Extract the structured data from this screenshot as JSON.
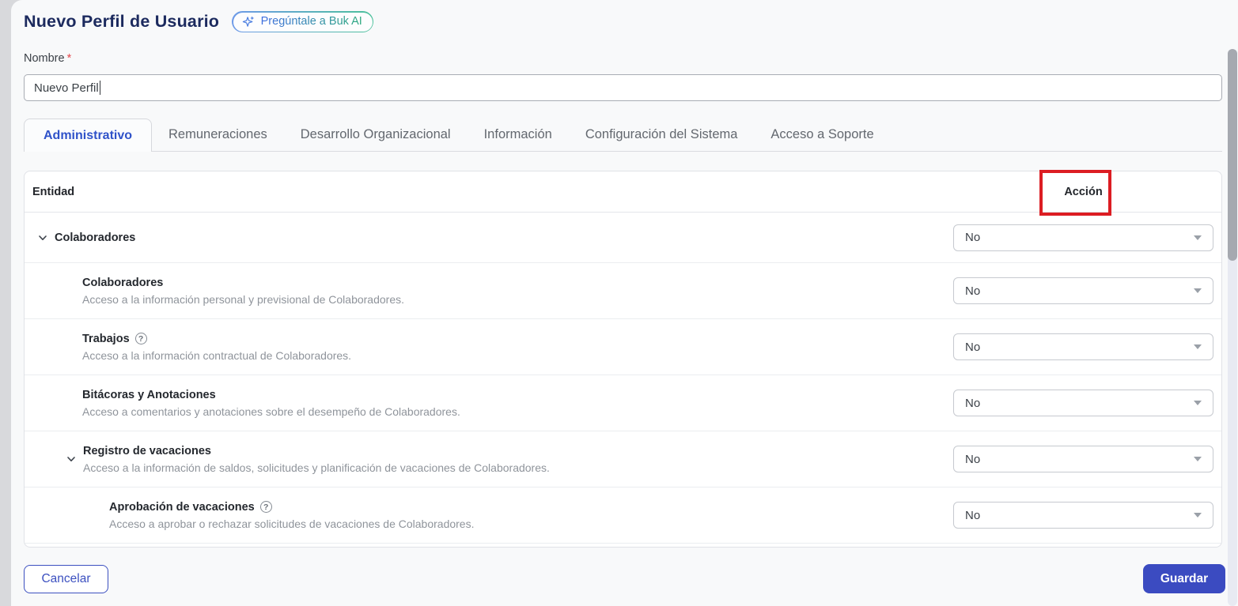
{
  "page": {
    "title": "Nuevo Perfil de Usuario",
    "ai_button_label": "Pregúntale a Buk AI"
  },
  "form": {
    "name_label": "Nombre",
    "required_marker": "*",
    "name_value": "Nuevo Perfil"
  },
  "tabs": [
    {
      "label": "Administrativo",
      "active": true
    },
    {
      "label": "Remuneraciones",
      "active": false
    },
    {
      "label": "Desarrollo Organizacional",
      "active": false
    },
    {
      "label": "Información",
      "active": false
    },
    {
      "label": "Configuración del Sistema",
      "active": false
    },
    {
      "label": "Acceso a Soporte",
      "active": false
    }
  ],
  "table": {
    "entity_header": "Entidad",
    "action_header": "Acción",
    "rows": [
      {
        "title": "Colaboradores",
        "level": 0,
        "expandable": true,
        "action": "No"
      },
      {
        "title": "Colaboradores",
        "desc": "Acceso a la información personal y previsional de Colaboradores.",
        "level": 1,
        "action": "No"
      },
      {
        "title": "Trabajos",
        "desc": "Acceso a la información contractual de Colaboradores.",
        "level": 1,
        "help": true,
        "action": "No"
      },
      {
        "title": "Bitácoras y Anotaciones",
        "desc": "Acceso a comentarios y anotaciones sobre el desempeño de Colaboradores.",
        "level": 1,
        "action": "No"
      },
      {
        "title": "Registro de vacaciones",
        "desc": "Acceso a la información de saldos, solicitudes y planificación de vacaciones de Colaboradores.",
        "level": 1,
        "expandable": true,
        "action": "No"
      },
      {
        "title": "Aprobación de vacaciones",
        "desc": "Acceso a aprobar o rechazar solicitudes de vacaciones de Colaboradores.",
        "level": 2,
        "help": true,
        "action": "No"
      }
    ]
  },
  "footer": {
    "cancel_label": "Cancelar",
    "save_label": "Guardar"
  },
  "annotation": {
    "highlight_color": "#dc1d23",
    "highlighted_element": "action_header"
  },
  "colors": {
    "accent_blue": "#3b4bc1",
    "title_navy": "#1c2a5e",
    "ai_gradient_start": "#3e6de0",
    "ai_gradient_end": "#2aa97d"
  }
}
